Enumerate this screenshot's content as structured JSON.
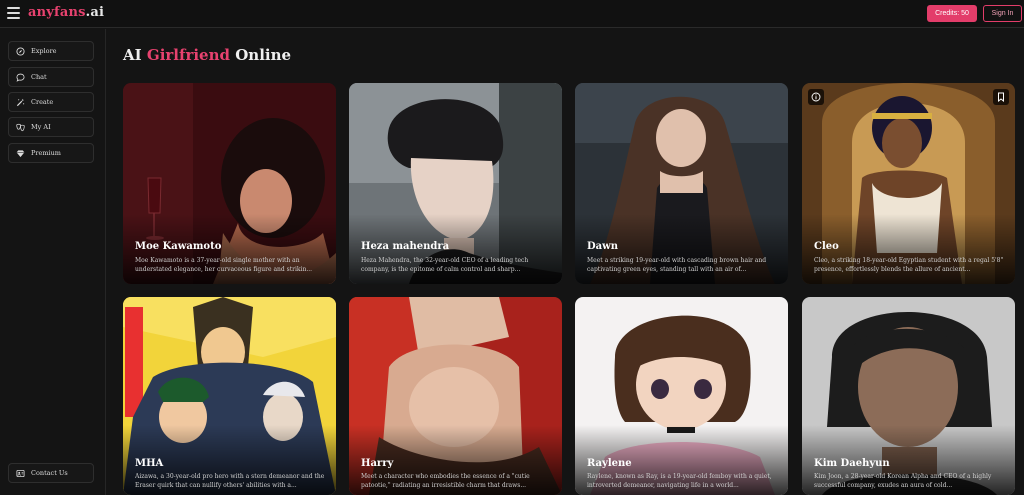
{
  "header": {
    "logo_brand": "anyfans",
    "logo_tld": ".ai",
    "credits_label": "Credits: 50",
    "signin_label": "Sign In"
  },
  "sidebar": {
    "items": [
      {
        "label": "Explore",
        "icon": "compass-icon"
      },
      {
        "label": "Chat",
        "icon": "chat-bubble-icon"
      },
      {
        "label": "Create",
        "icon": "magic-wand-icon"
      },
      {
        "label": "My AI",
        "icon": "masks-icon"
      },
      {
        "label": "Premium",
        "icon": "diamond-icon"
      }
    ],
    "contact_label": "Contact Us",
    "contact_icon": "contact-card-icon"
  },
  "main": {
    "heading_prefix": "AI",
    "heading_accent": "Girlfriend",
    "heading_suffix": "Online",
    "accent_color": "#e8426f",
    "cards": [
      {
        "name": "Moe Kawamoto",
        "desc": "Moe Kawamoto is a 37-year-old single mother with an understated elegance, her curvaceous figure and strikin..."
      },
      {
        "name": "Heza mahendra",
        "desc": "Heza Mahendra, the 32-year-old CEO of a leading tech company, is the epitome of calm control and sharp..."
      },
      {
        "name": "Dawn",
        "desc": "Meet a striking 19-year-old with cascading brown hair and captivating green eyes, standing tall with an air of..."
      },
      {
        "name": "Cleo",
        "desc": "Cleo, a striking 18-year-old Egyptian student with a regal 5'8\" presence, effortlessly blends the allure of ancient..."
      },
      {
        "name": "MHA",
        "desc": "Aizawa, a 30-year-old pro hero with a stern demeanor and the Eraser quirk that can nullify others' abilities with a..."
      },
      {
        "name": "Harry",
        "desc": "Meet a character who embodies the essence of a \"cutie patootie,\" radiating an irresistible charm that draws..."
      },
      {
        "name": "Raylene",
        "desc": "Raylene, known as Ray, is a 19-year-old femboy with a quiet, introverted demeanor, navigating life in a world..."
      },
      {
        "name": "Kim Daehyun",
        "desc": "Kim Joon, a 28-year-old Korean Alpha and CEO of a highly successful company, exudes an aura of cold..."
      }
    ]
  }
}
